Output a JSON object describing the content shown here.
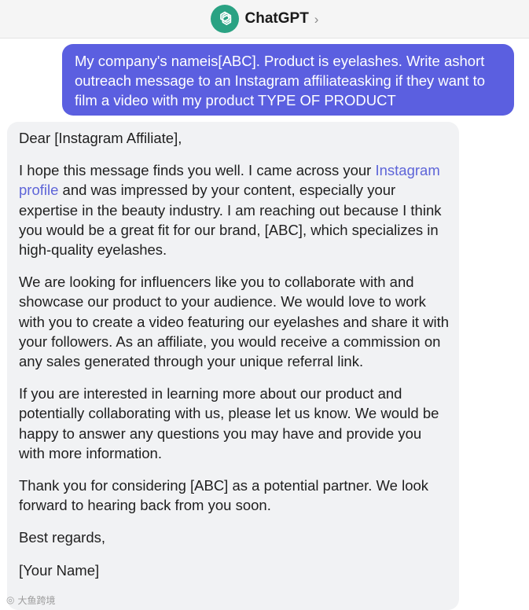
{
  "header": {
    "title": "ChatGPT",
    "chevron": "›",
    "logo_icon": "openai-logo-icon",
    "logo_color": "#2aa283"
  },
  "user_message": {
    "text": "My company's nameis[ABC]. Product is eyelashes. Write ashort outreach message to an Instagram affiliateasking if they want to film a video with my product TYPE OF PRODUCT",
    "bubble_color": "#5b5fe0"
  },
  "assistant_message": {
    "greeting": "Dear [Instagram Affiliate],",
    "p1_before": "I hope this message finds you well. I came across your ",
    "p1_link": "Instagram profile",
    "p1_after": " and was impressed by your content, especially your expertise in the beauty industry. I am reaching out because I think you would be a great fit for our brand, [ABC], which specializes in high-quality eyelashes.",
    "p2": "We are looking for influencers like you to collaborate with and showcase our product to your audience. We would love to work with you to create a video featuring our eyelashes and share it with your followers. As an affiliate, you would receive a commission on any sales generated through your unique referral link.",
    "p3": "If you are interested in learning more about our product and potentially collaborating with us, please let us know. We would be happy to answer any questions you may have and provide you with more information.",
    "p4": "Thank you for considering [ABC] as a potential partner. We look forward to hearing back from you soon.",
    "closing": "Best regards,",
    "signature": "[Your Name]",
    "bubble_color": "#f1f2f4",
    "link_color": "#5d64d8"
  },
  "watermark": {
    "text": "大鱼跨境"
  }
}
